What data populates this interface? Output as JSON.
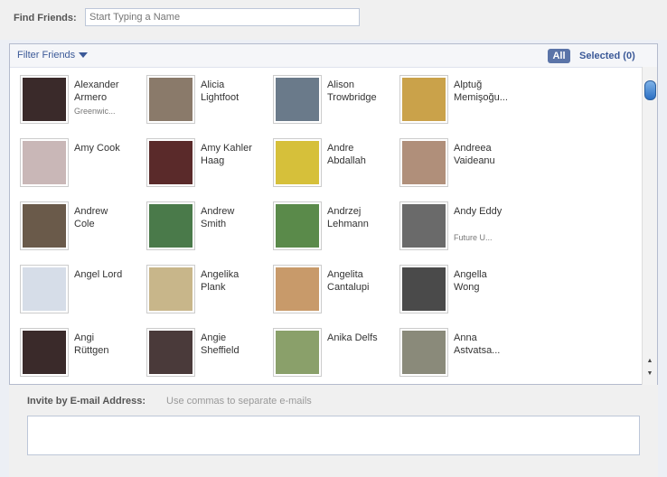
{
  "find": {
    "label": "Find Friends:",
    "placeholder": "Start Typing a Name"
  },
  "filter": {
    "label": "Filter Friends",
    "all": "All",
    "selected": "Selected (0)"
  },
  "friends": [
    {
      "name": "Alexander\nArmero",
      "sub": "Greenwic...",
      "photo": "#3a2a2a"
    },
    {
      "name": "Alicia\nLightfoot",
      "sub": "",
      "photo": "#8a7a6a"
    },
    {
      "name": "Alison\nTrowbridge",
      "sub": "",
      "photo": "#6a7a8a"
    },
    {
      "name": "Alptuğ\nMemişoğu...",
      "sub": "",
      "photo": "#caa24a"
    },
    {
      "name": "Amy Cook",
      "sub": "",
      "photo": "#c9b7b7"
    },
    {
      "name": "Amy Kahler\nHaag",
      "sub": "",
      "photo": "#5a2a2a"
    },
    {
      "name": "Andre\nAbdallah",
      "sub": "",
      "photo": "#d6c03a"
    },
    {
      "name": "Andreea\nVaideanu",
      "sub": "",
      "photo": "#b08f7a"
    },
    {
      "name": "Andrew\nCole",
      "sub": "",
      "photo": "#6a5a4a"
    },
    {
      "name": "Andrew\nSmith",
      "sub": "",
      "photo": "#4a7a4a"
    },
    {
      "name": "Andrzej\nLehmann",
      "sub": "",
      "photo": "#5a8a4a"
    },
    {
      "name": "Andy Eddy",
      "sub": "Future U...",
      "photo": "#6a6a6a"
    },
    {
      "name": "Angel Lord",
      "sub": "",
      "photo": "#d6dde8"
    },
    {
      "name": "Angelika\nPlank",
      "sub": "",
      "photo": "#c8b68a"
    },
    {
      "name": "Angelita\nCantalupi",
      "sub": "",
      "photo": "#c89a6a"
    },
    {
      "name": "Angella\nWong",
      "sub": "",
      "photo": "#4a4a4a"
    },
    {
      "name": "Angi\nRüttgen",
      "sub": "",
      "photo": "#3a2a2a"
    },
    {
      "name": "Angie\nSheffield",
      "sub": "",
      "photo": "#4a3a3a"
    },
    {
      "name": "Anika Delfs",
      "sub": "",
      "photo": "#8aa06a"
    },
    {
      "name": "Anna\nAstvatsa...",
      "sub": "",
      "photo": "#8a8a7a"
    }
  ],
  "invite": {
    "label": "Invite by E-mail Address:",
    "hint": "Use commas to separate e-mails"
  },
  "colors": {
    "link": "#3b5998",
    "accent": "#5b74a8"
  }
}
